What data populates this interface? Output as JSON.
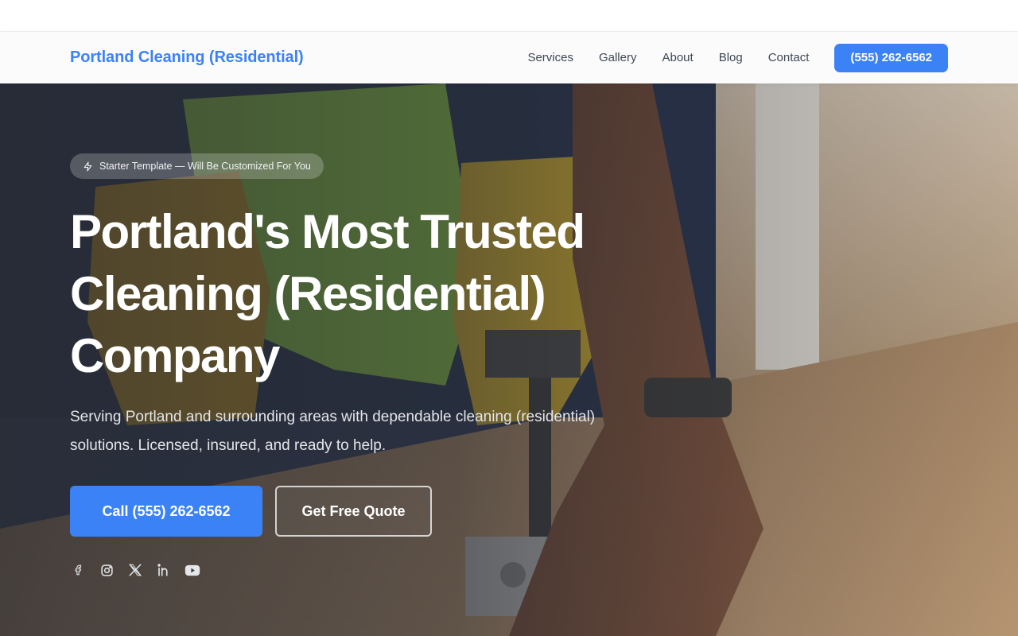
{
  "brand": {
    "name": "Portland Cleaning (Residential)"
  },
  "nav": {
    "links": [
      "Services",
      "Gallery",
      "About",
      "Blog",
      "Contact"
    ],
    "phone_button": "(555) 262-6562"
  },
  "hero": {
    "badge": "Starter Template — Will Be Customized For You",
    "headline": "Portland's Most Trusted Cleaning (Residential) Company",
    "subtext": "Serving Portland and surrounding areas with dependable cleaning (residential) solutions. Licensed, insured, and ready to help.",
    "primary_button": "Call (555) 262-6562",
    "secondary_button": "Get Free Quote",
    "socials": [
      "facebook-icon",
      "instagram-icon",
      "x-icon",
      "linkedin-icon",
      "youtube-icon"
    ]
  },
  "colors": {
    "accent": "#3b82f6",
    "nav_text": "#3f4753",
    "hero_text": "#ffffff"
  }
}
